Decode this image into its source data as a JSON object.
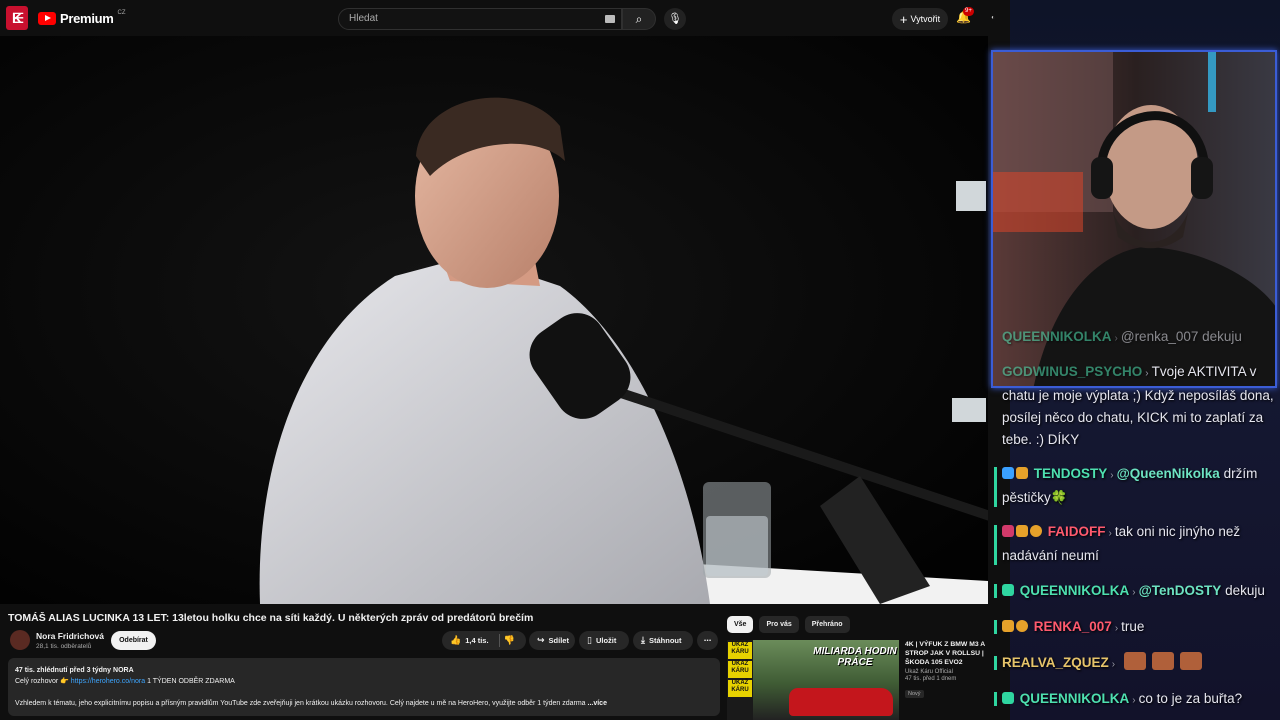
{
  "youtube": {
    "logo_text": "Premium",
    "logo_region": "CZ",
    "search_placeholder": "Hledat",
    "create_label": "Vytvořit",
    "notifications_count": "9+",
    "video": {
      "title": "TOMÁŠ ALIAS LUCINKA 13 LET: 13letou holku chce na síti každý. U některých zpráv od predátorů brečím",
      "channel_name": "Nora Fridrichová",
      "channel_subs": "28,1 tis. odběratelů",
      "subscribe_label": "Odebírat",
      "like_count": "1,4 tis.",
      "share_label": "Sdílet",
      "save_label": "Uložit",
      "download_label": "Stáhnout",
      "description_meta": "47 tis. zhlédnutí  před 3 týdny  NORA",
      "description_line2_pre": "Celý rozhovor 👉 ",
      "description_link": "https://herohero.co/nora",
      "description_line2_post": " 1 TÝDEN ODBĚR ZDARMA",
      "description_line3": "Vzhledem k tématu, jeho explicitnímu popisu a přísným pravidlům YouTube zde zveřejňuji jen krátkou ukázku rozhovoru. Celý najdete u mě na HeroHero, využijte odběr 1 týden zdarma",
      "more_label": "...více"
    },
    "chips": [
      "Vše",
      "Pro vás",
      "Přehráno"
    ],
    "recommended": {
      "thumb_strip_labels": [
        "UKAŽ KÁRU",
        "UKAŽ KÁRU",
        "UKAŽ KÁRU"
      ],
      "thumb_headline": "MILIARDA HODIN PRÁCE",
      "title": "4K | VÝFUK Z BMW M3 A STROP JAK V ROLLSU | ŠKODA 105 EVO2",
      "channel": "Ukaž Káru Official",
      "meta": "47 tis.  před 1 dnem",
      "badge": "Nový"
    }
  },
  "stream_chat": {
    "messages": [
      {
        "user": "QUEENNIKOLKA",
        "text": "@renka_007 dekuju",
        "dim": true
      },
      {
        "user": "GODWINUS_PSYCHO",
        "text": "Tvoje AKTIVITA v chatu je moje výplata ;) Když neposíláš dona, posílej něco do chatu, KICK mi to zaplatí za tebe. :) DÍKY",
        "dim": false
      },
      {
        "user": "TENDOSTY",
        "mention": "@QueenNikolka",
        "text": "držím pěstičky🍀",
        "nick_color": "#4ee0b0"
      },
      {
        "user": "FAIDOFF",
        "text": "tak oni nic jinýho než nadávání neumí",
        "nick_color": "#ff5a6e"
      },
      {
        "user": "QUEENNIKOLKA",
        "mention": "@TenDOSTY",
        "text": "dekuju",
        "nick_color": "#4ee0b0"
      },
      {
        "user": "RENKA_007",
        "text": "true",
        "nick_color": "#ff5a6e"
      },
      {
        "user": "REALVA_ZQUEZ",
        "text": "",
        "nick_color": "#e6c46a"
      },
      {
        "user": "QUEENNIKOLKA",
        "text": "co to je za buřta?",
        "nick_color": "#4ee0b0"
      }
    ]
  }
}
